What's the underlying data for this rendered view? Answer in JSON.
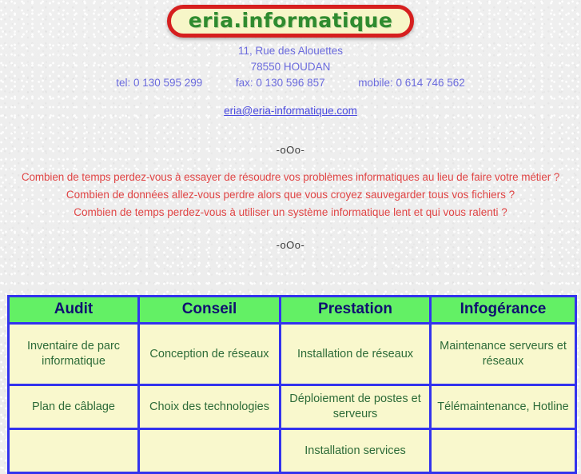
{
  "logo": {
    "text": "eria.informatique",
    "text_color": "#2f8b2f",
    "fill_color": "#f7f6c8",
    "border_color": "#d61f1f"
  },
  "contact": {
    "street": "11, Rue des Alouettes",
    "city": "78550 HOUDAN",
    "tel": "tel: 0 130 595 299",
    "fax": "fax: 0 130 596 857",
    "mobile": "mobile: 0 614 746 562",
    "email": "eria@eria-informatique.com",
    "text_color": "#6b6bdd",
    "link_color": "#4a4ae0"
  },
  "separators": {
    "first": "-oOo-",
    "second": "-oOo-"
  },
  "questions": {
    "color": "#e04545",
    "items": [
      "Combien de temps perdez-vous à essayer de résoudre vos problèmes informatiques au lieu de faire votre métier ?",
      "Combien de données allez-vous perdre alors que vous croyez sauvegarder tous vos fichiers ?",
      "Combien de temps perdez-vous à utiliser un système informatique lent et qui vous ralenti ?"
    ]
  },
  "services_table": {
    "header_bg": "#63f065",
    "header_color": "#101070",
    "cell_bg": "#f9f8cd",
    "cell_color": "#2d6b38",
    "border_color": "#3333ee",
    "headers": [
      "Audit",
      "Conseil",
      "Prestation",
      "Infogérance"
    ],
    "rows": [
      [
        "Inventaire de parc informatique",
        "Conception de réseaux",
        "Installation de réseaux",
        "Maintenance serveurs et réseaux"
      ],
      [
        "Plan de câblage",
        "Choix des technologies",
        "Déploiement de postes et serveurs",
        "Télémaintenance, Hotline"
      ],
      [
        "",
        "",
        "Installation services",
        ""
      ]
    ]
  }
}
